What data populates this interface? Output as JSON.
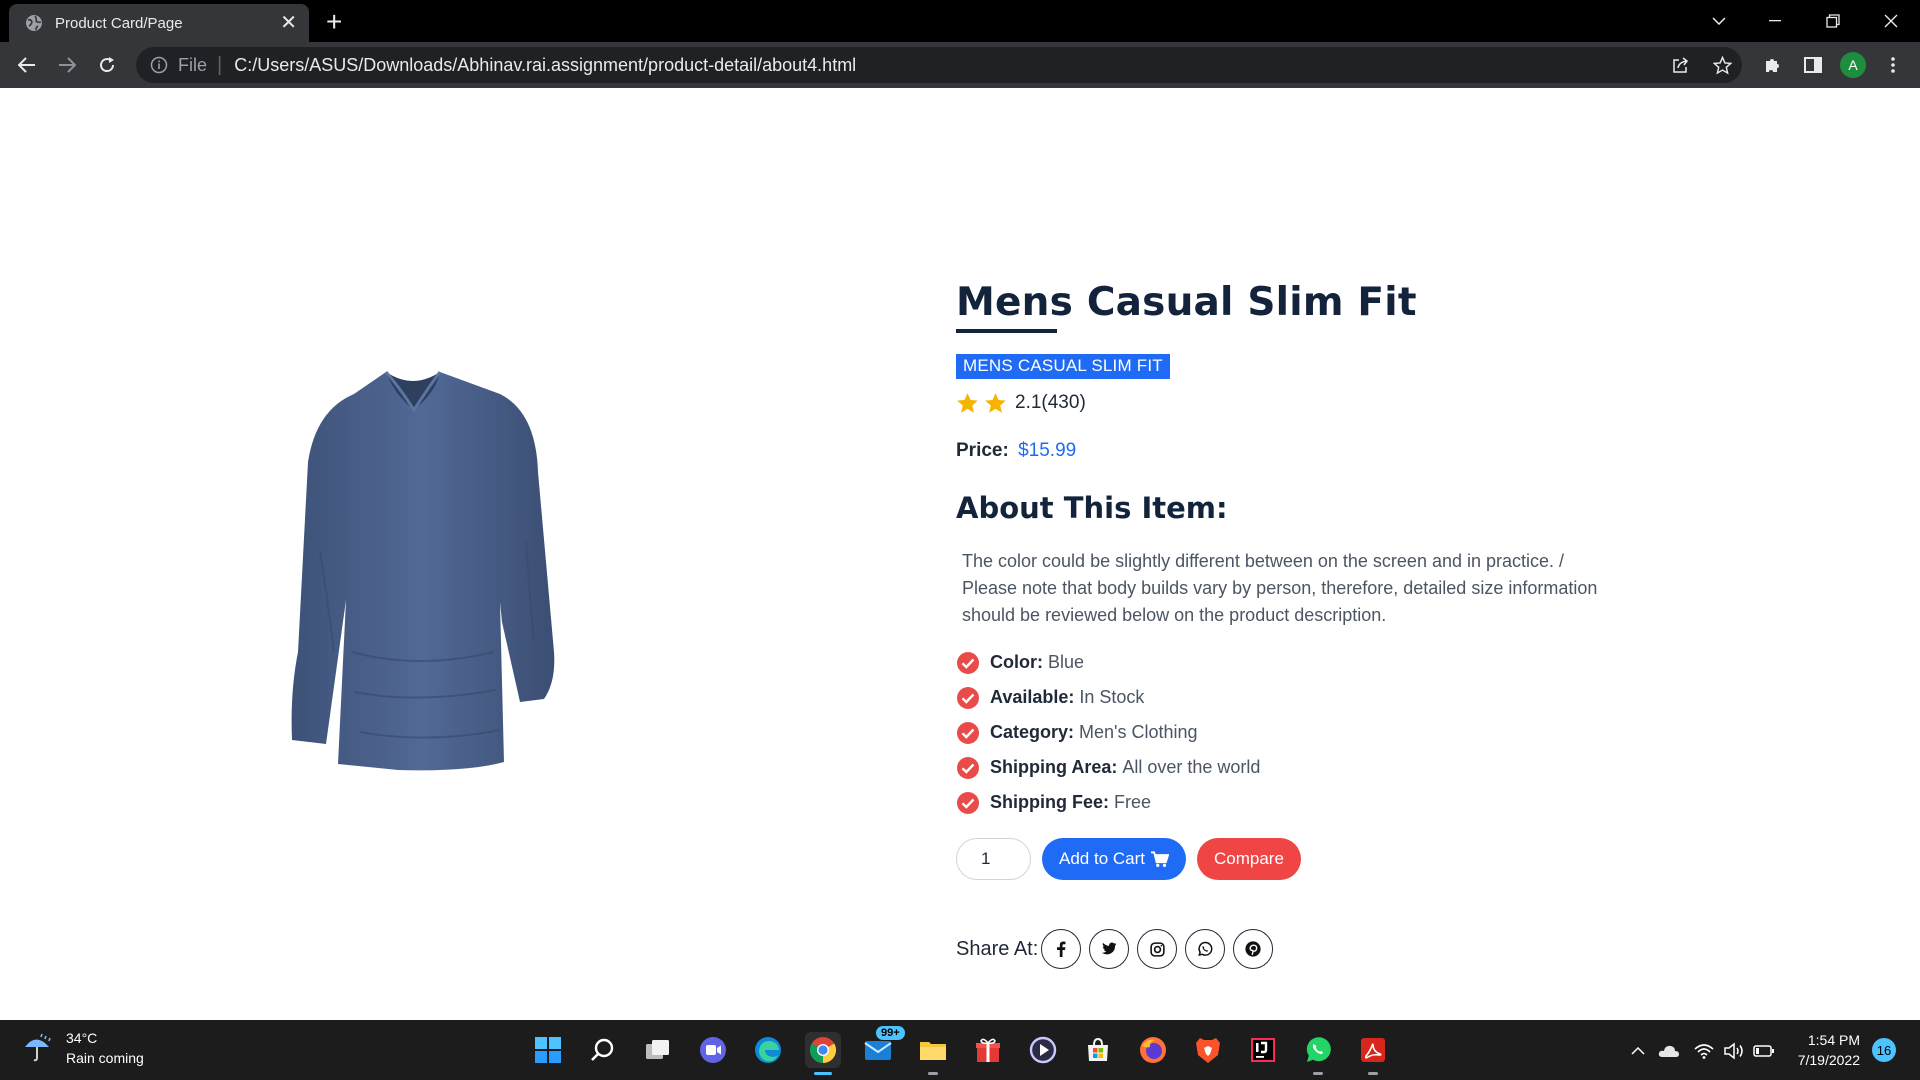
{
  "browser": {
    "tab_title": "Product Card/Page",
    "url_scheme": "File",
    "url": "C:/Users/ASUS/Downloads/Abhinav.rai.assignment/product-detail/about4.html"
  },
  "profile": {
    "initial": "A",
    "color": "#1e8e3e"
  },
  "product": {
    "title": "Mens Casual Slim Fit",
    "badge": "MENS CASUAL SLIM FIT",
    "rating": "2.1(430)",
    "star_count": 2,
    "price_label": "Price:",
    "price_value": "$15.99",
    "about_heading": "About This Item:",
    "description": "The color could be slightly different between on the screen and in practice. / Please note that body builds vary by person, therefore, detailed size information should be reviewed below on the product description.",
    "specs": [
      {
        "key": "Color:",
        "value": "Blue"
      },
      {
        "key": "Available:",
        "value": "In Stock"
      },
      {
        "key": "Category:",
        "value": "Men's Clothing"
      },
      {
        "key": "Shipping Area:",
        "value": "All over the world"
      },
      {
        "key": "Shipping Fee:",
        "value": "Free"
      }
    ],
    "quantity": "1",
    "add_to_cart_label": "Add to Cart",
    "compare_label": "Compare",
    "share_label": "Share At:",
    "share_icons": [
      "facebook-icon",
      "twitter-icon",
      "instagram-icon",
      "whatsapp-icon",
      "pinterest-icon"
    ]
  },
  "colors": {
    "accent": "#1f6bf5",
    "compare": "#f04545",
    "heading": "#12233b",
    "check": "#e94b4b",
    "star": "#f6b400",
    "shirt": "#4a5f86"
  },
  "taskbar": {
    "weather_temp": "34°C",
    "weather_desc": "Rain coming",
    "mail_badge": "99+",
    "time": "1:54 PM",
    "date": "7/19/2022",
    "notifications": "16"
  }
}
